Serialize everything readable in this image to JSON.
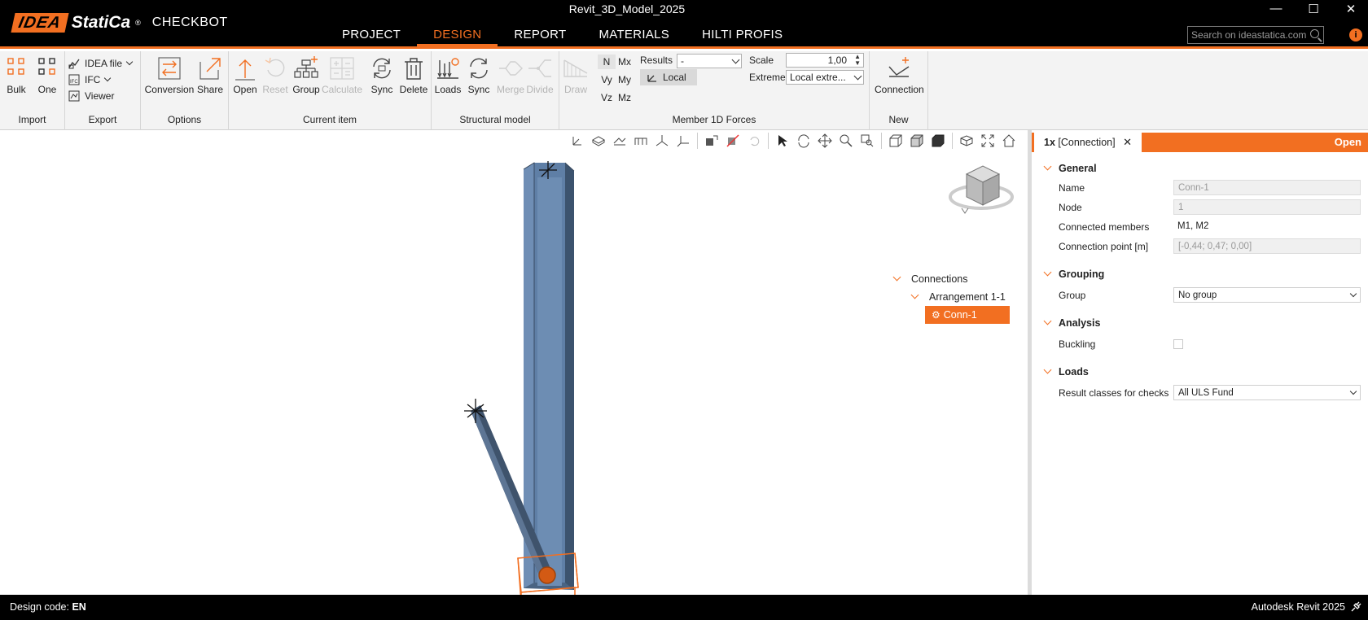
{
  "app": {
    "logo_prefix": "IDEA",
    "logo_name": "StatiCa",
    "logo_reg": "®",
    "product": "CHECKBOT",
    "window_title": "Revit_3D_Model_2025",
    "accent_color": "#f26f21"
  },
  "window_controls": {
    "minimize": "—",
    "maximize": "☐",
    "close": "✕"
  },
  "menu_tabs": [
    {
      "label": "PROJECT"
    },
    {
      "label": "DESIGN",
      "active": true
    },
    {
      "label": "REPORT"
    },
    {
      "label": "MATERIALS"
    },
    {
      "label": "HILTI PROFIS"
    }
  ],
  "search": {
    "placeholder": "Search on ideastatica.com"
  },
  "ribbon": {
    "import": {
      "label": "Import",
      "bulk": "Bulk",
      "one": "One"
    },
    "export": {
      "label": "Export",
      "idea_file": "IDEA file",
      "ifc": "IFC",
      "viewer": "Viewer"
    },
    "options": {
      "label": "Options",
      "conversion": "Conversion",
      "share": "Share"
    },
    "current_item": {
      "label": "Current item",
      "open": "Open",
      "reset": "Reset",
      "group": "Group",
      "calculate": "Calculate",
      "sync": "Sync",
      "delete": "Delete"
    },
    "structural_model": {
      "label": "Structural model",
      "loads": "Loads",
      "sync": "Sync",
      "merge": "Merge",
      "divide": "Divide"
    },
    "member_forces": {
      "label": "Member 1D Forces",
      "draw": "Draw",
      "forces": [
        "N",
        "Mx",
        "Vy",
        "My",
        "Vz",
        "Mz"
      ],
      "results_label": "Results",
      "results_value": "-",
      "local_label": "Local",
      "scale_label": "Scale",
      "scale_value": "1,00",
      "extreme_label": "Extreme",
      "extreme_value": "Local extre..."
    },
    "new": {
      "label": "New",
      "connection": "Connection"
    }
  },
  "tree": {
    "root": "Connections",
    "arrangement": "Arrangement 1-1",
    "selected": "Conn-1"
  },
  "panel": {
    "tab_count": "1x",
    "tab_label": "[Connection]",
    "tab_close": "✕",
    "open_label": "Open",
    "general": {
      "title": "General",
      "name_label": "Name",
      "name_value": "Conn-1",
      "node_label": "Node",
      "node_value": "1",
      "members_label": "Connected members",
      "members_value": "M1, M2",
      "point_label": "Connection point [m]",
      "point_value": "[-0,44; 0,47; 0,00]"
    },
    "grouping": {
      "title": "Grouping",
      "group_label": "Group",
      "group_value": "No group"
    },
    "analysis": {
      "title": "Analysis",
      "buckling_label": "Buckling",
      "buckling_checked": false
    },
    "loads": {
      "title": "Loads",
      "result_label": "Result classes for checks",
      "result_value": "All ULS Fund"
    }
  },
  "status": {
    "design_code_label": "Design code:",
    "design_code_value": "EN",
    "right_text": "Autodesk Revit 2025"
  }
}
